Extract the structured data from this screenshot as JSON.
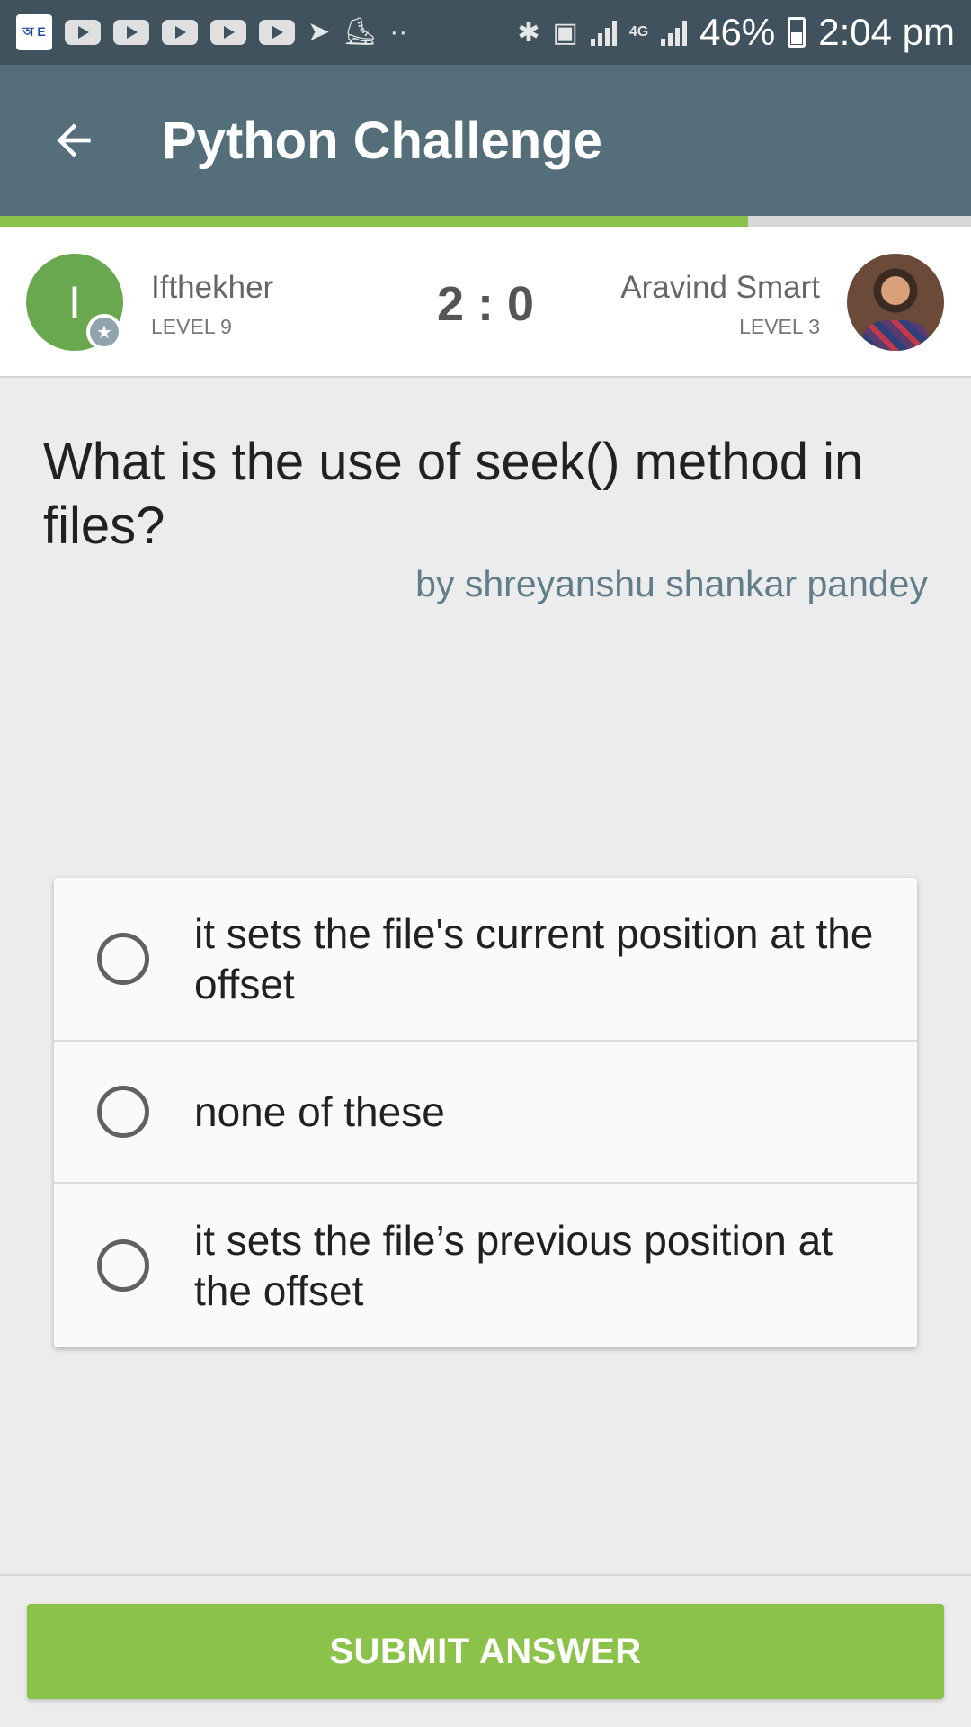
{
  "status_bar": {
    "app_icon_text": "অ E",
    "battery": "46%",
    "time": "2:04 pm",
    "network_type": "4G",
    "icons": [
      "book-app-icon",
      "youtube-icon",
      "youtube-icon",
      "youtube-icon",
      "youtube-icon",
      "youtube-icon",
      "telegram-icon",
      "shoe-icon",
      "more-dots-icon",
      "bluetooth-icon",
      "sim-icon",
      "signal-icon",
      "signal-icon",
      "battery-icon"
    ]
  },
  "app_bar": {
    "title": "Python Challenge",
    "back_icon": "arrow-left-icon",
    "progress_fraction": 0.77
  },
  "players": {
    "left": {
      "initial": "I",
      "name": "Ifthekher",
      "level": "LEVEL 9",
      "avatar_color": "#6aa84f"
    },
    "score": "2 : 0",
    "right": {
      "name": "Aravind Smart",
      "level": "LEVEL 3"
    }
  },
  "question": {
    "text": "What is the use of seek() method in files?",
    "author": "by shreyanshu shankar pandey"
  },
  "options": [
    {
      "text": "it sets the file's current position at the offset",
      "selected": false
    },
    {
      "text": "none of these",
      "selected": false
    },
    {
      "text": "it sets the file’s previous position at the offset",
      "selected": false
    }
  ],
  "submit": {
    "label": "SUBMIT ANSWER"
  },
  "colors": {
    "app_bar": "#546e7a",
    "status_bar": "#3f525d",
    "accent_green": "#8bc34a",
    "author_text": "#607d8b"
  }
}
